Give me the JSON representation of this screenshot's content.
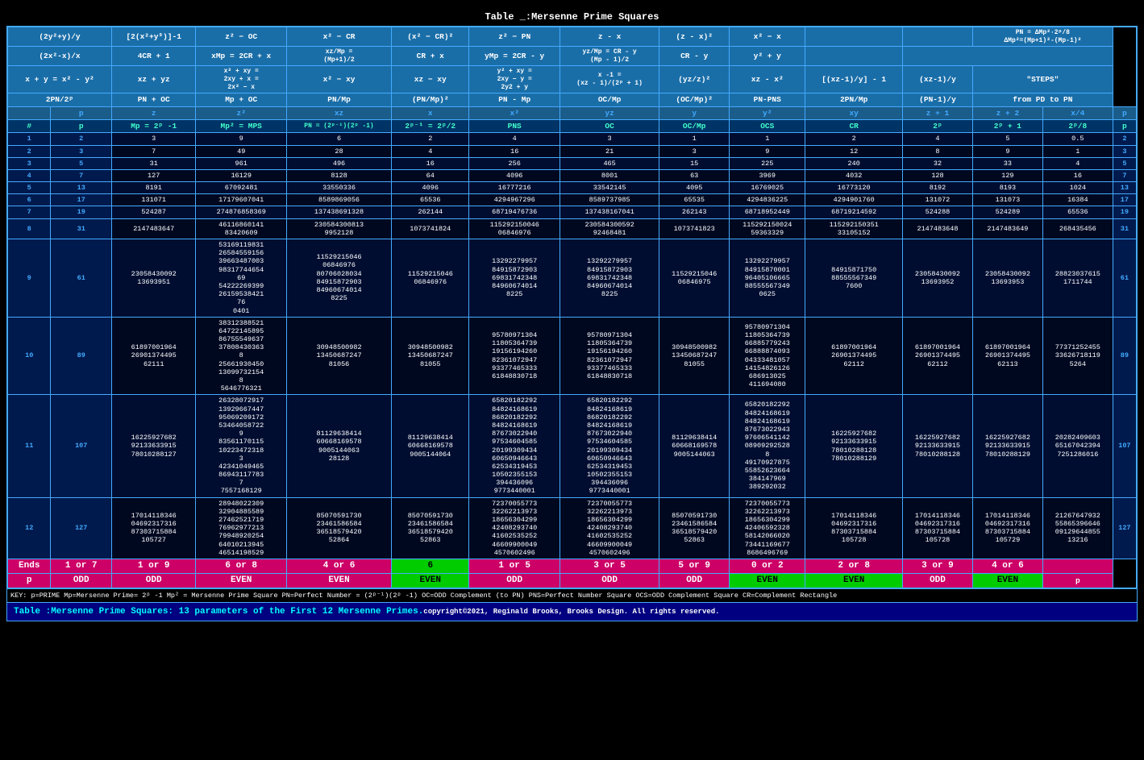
{
  "title": "Table  _:Mersenne Prime Squares",
  "footer": "Table   :Mersenne Prime Squares: 13 parameters of the First 12 Mersenne Primes.",
  "footer_copy": "copyright©2021, Reginald Brooks, Brooks Design. All rights reserved.",
  "key_text": "KEY:  p=PRIME      Mp=Mersenne Prime= 2ᵖ -1      Mp² = Mersenne Prime Square      PN=Perfect Number = (2ᵖ⁻¹)(2ᵖ -1)      OC=ODD Complement (to PN)      PNS=Perfect Number Square      OCS=ODD Complement Square      CR=Complement Rectangle",
  "headers": {
    "row1": [
      "(2y²+y)/y",
      "[2(x²+y⁹)]-1",
      "z² − OC",
      "x² − CR",
      "(x² − CR)²",
      "z² − PN",
      "z - x",
      "(z - x)²",
      "x² − x",
      "",
      "",
      "PN = ΔMp²·2ᵖ/8"
    ],
    "row1_last": "PN = ΔMp²·2ᵖ/8\nΔMp²=(Mp+1)²-\n(Mp-1)²",
    "row2": [
      "(2x²-x)/x",
      "4CR + 1",
      "xMp = 2CR + x",
      "xz/Mp =\n(Mp+1)/2",
      "CR + x",
      "yMp = 2CR - y",
      "yz/Mp = CR - y\n(Mp - 1)/2",
      "CR - y",
      "y² + y",
      "",
      ""
    ],
    "row3": [
      "x + y = x² - y²",
      "xz + yz",
      "x² + xy =\n2xy + x =\n2x² − x",
      "x² − xy",
      "xz − xy",
      "y² + xy =\n2xy − y =\n2y2 + y",
      "x -1 =\n(xz - 1)/(2ᵖ + 1)",
      "(yz/z)²",
      "xz - x²",
      "[(xz-1)/y] - 1",
      "(xz-1)/y",
      "\"STEPS\""
    ],
    "row4": [
      "2PN/2ᵖ",
      "PN + OC",
      "Mp + OC",
      "PN/Mp",
      "(PN/Mp)²",
      "PN - Mp",
      "OC/Mp",
      "(OC/Mp)²",
      "PN-PNS",
      "2PN/Mp",
      "(PN-1)/y",
      "from PD to PN"
    ],
    "row5": [
      "p",
      "z",
      "z²",
      "xz",
      "x",
      "x²",
      "yz",
      "y",
      "y²",
      "xy",
      "z + 1",
      "z + 2",
      "x/4",
      "p"
    ],
    "row6": [
      "#",
      "p",
      "Mp = 2ᵖ -1",
      "Mp² = MPS",
      "PN = (2ᵖ⁻¹)(2ᵖ -1)",
      "2ᵖ⁻¹ = 2ᵖ/2",
      "PNS",
      "OC",
      "OC/Mp",
      "OCS",
      "CR",
      "2ᵖ",
      "2ᵖ + 1",
      "2ᵖ/8",
      "p"
    ]
  },
  "rows": [
    {
      "num": "1",
      "p": "2",
      "mp": "3",
      "mps": "9",
      "pn": "6",
      "half": "2",
      "pns": "4",
      "oc": "3",
      "ocmp": "1",
      "ocs": "1",
      "cr": "2",
      "pow2": "4",
      "pow2p1": "5",
      "pow2d8": "0.5",
      "pr": "2"
    },
    {
      "num": "2",
      "p": "3",
      "mp": "7",
      "mps": "49",
      "pn": "28",
      "half": "4",
      "pns": "16",
      "oc": "21",
      "ocmp": "3",
      "ocs": "9",
      "cr": "12",
      "pow2": "8",
      "pow2p1": "9",
      "pow2d8": "1",
      "pr": "3"
    },
    {
      "num": "3",
      "p": "5",
      "mp": "31",
      "mps": "961",
      "pn": "496",
      "half": "16",
      "pns": "256",
      "oc": "465",
      "ocmp": "15",
      "ocs": "225",
      "cr": "240",
      "pow2": "32",
      "pow2p1": "33",
      "pow2d8": "4",
      "pr": "5"
    },
    {
      "num": "4",
      "p": "7",
      "mp": "127",
      "mps": "16129",
      "pn": "8128",
      "half": "64",
      "pns": "4096",
      "oc": "8001",
      "ocmp": "63",
      "ocs": "3969",
      "cr": "4032",
      "pow2": "128",
      "pow2p1": "129",
      "pow2d8": "16",
      "pr": "7"
    },
    {
      "num": "5",
      "p": "13",
      "mp": "8191",
      "mps": "67092481",
      "pn": "33550336",
      "half": "4096",
      "pns": "16777216",
      "oc": "33542145",
      "ocmp": "4095",
      "ocs": "16769025",
      "cr": "16773120",
      "pow2": "8192",
      "pow2p1": "8193",
      "pow2d8": "1024",
      "pr": "13"
    },
    {
      "num": "6",
      "p": "17",
      "mp": "131071",
      "mps": "17179607041",
      "pn": "8589869056",
      "half": "65536",
      "pns": "4294967296",
      "oc": "8589737985",
      "ocmp": "65535",
      "ocs": "4294836225",
      "cr": "4294901760",
      "pow2": "131072",
      "pow2p1": "131073",
      "pow2d8": "16384",
      "pr": "17"
    },
    {
      "num": "7",
      "p": "19",
      "mp": "524287",
      "mps": "274876858369",
      "pn": "137438691328",
      "half": "262144",
      "pns": "68719476736",
      "oc": "137438167041",
      "ocmp": "262143",
      "ocs": "68718952449",
      "cr": "68719214592",
      "pow2": "524288",
      "pow2p1": "524289",
      "pow2d8": "65536",
      "pr": "19"
    },
    {
      "num": "8",
      "p": "31",
      "mp": "2147483647",
      "mps": "46116860141\n83420609",
      "pn": "230584300813\n9952128",
      "half": "1073741824",
      "pns": "115292150046\n06846976",
      "oc": "230584300592\n92468481",
      "ocmp": "1073741823",
      "ocs": "115292150024\n59363329",
      "cr": "115292150351\n33105152",
      "pow2": "2147483648",
      "pow2p1": "2147483649",
      "pow2d8": "268435456",
      "pr": "31"
    },
    {
      "num": "9",
      "p": "61",
      "mp": "23058430092\n13693951",
      "mps": "53169119831\n26584559156\n39663487003\n98317744654\n69\n54222269399\n26159538421\n76\n0401",
      "pn": "11529215046\n06846976\n80706028034\n84915872903\n84960674014\n8225",
      "half": "11529215046\n06846976",
      "pns": "13292279957\n84915872903\n69831742348\n84960674014\n8225",
      "oc": "13292279957\n84915872903\n69831742348\n84960674014\n8225",
      "ocmp": "11529215046\n06846975",
      "ocs": "13292279957\n84915870001\n96405106665\n88555567349\n0625",
      "cr": "84915871750\n88555567349\n7600",
      "pow2": "23058430092\n13693952",
      "pow2p1": "23058430092\n13693953",
      "pow2d8": "28823037615\n1711744",
      "pr": "61"
    },
    {
      "num": "10",
      "p": "89",
      "mp": "61897001964\n26901374495\n62111",
      "mps": "38312388521\n64722145895\n86755549637\n37808430363\n8\n25661930450\n13099732154\n8\n5646776321",
      "pn": "30948500982\n13450687247\n81056",
      "half": "30948500982\n13450687247\n81055",
      "pns": "95780971304\n11805364739\n19156194260\n82361072947\n93377465333\n61848830718",
      "oc": "95780971304\n11805364739\n19156194260\n82361072947\n93377465333\n61848830718",
      "ocmp": "30948500982\n13450687247\n81055",
      "ocs": "95780971304\n11805364739\n66885779243\n66888874093\n04333481057\n14154826126\n686913025\n411694080",
      "cr": "61897001964\n26901374495\n62112",
      "pow2": "61897001964\n26901374495\n62112",
      "pow2p1": "61897001964\n26901374495\n62113",
      "pow2d8": "77371252455\n33626718119\n5264",
      "pr": "89"
    },
    {
      "num": "11",
      "p": "107",
      "mp": "16225927682\n92133633915\n78010288127",
      "mps": "26328072917\n13929667447\n95069209172\n53464058722\n9\n83561170115\n10223472318\n3\n42341049465\n86943117783\n7\n7557168129",
      "pn": "81129638414\n60668169578\n9005144063\n28128",
      "half": "81129638414\n60668169578\n9005144064",
      "pns": "65820182292\n84824168619\n86820182292\n84824168619\n87673022940\n97534604585\n20199309434\n60650946643\n62534319453\n10502355153\n394436096\n9773440001",
      "oc": "65820182292\n84824168619\n86820182292\n84824168619\n87673022940\n97534604585\n20199309434\n60650946643\n62534319453\n10502355153\n394436096\n9773440001",
      "ocmp": "81129638414\n60668169578\n9005144063",
      "ocs": "65820182292\n84824168619\n84824168619\n87673022943\n97606541142\n08909292528\n8\n49170927875\n55852623664\n384147969\n389292032",
      "cr": "16225927682\n92133633915\n78010288128\n78010288129",
      "pow2": "16225927682\n92133633915\n78010288128",
      "pow2p1": "16225927682\n92133633915\n78010288129",
      "pow2d8": "20282409603\n65167042394\n7251286016",
      "pr": "107"
    },
    {
      "num": "12",
      "p": "127",
      "mp": "17014118346\n04692317316\n87303715884\n105727",
      "mps": "28948022309\n32904885589\n27462521719\n76962977213\n79948920254\n64010213945\n46514198529",
      "pn": "85070591730\n23461586584\n36518579420\n52864",
      "half": "85070591730\n23461586584\n36518579420\n52863",
      "pns": "72370055773\n32262213973\n18656304299\n42408293740\n41602535252\n46609900049\n4570602496",
      "oc": "72370055773\n32262213973\n18656304299\n42408293740\n41602535252\n46609900049\n4570602496",
      "ocmp": "85070591730\n23461586584\n36518579420\n52863",
      "ocs": "72370055773\n32262213973\n18656304299\n42406592328\n58142066020\n73441169677\n8686496769",
      "cr": "17014118346\n04692317316\n87303715884\n105728",
      "pow2": "17014118346\n04692317316\n87303715884\n105728",
      "pow2p1": "17014118346\n04692317316\n87303715884\n105729",
      "pow2d8": "21267647932\n55865396646\n09129644855\n13216",
      "pr": "127"
    }
  ],
  "ends_row": {
    "label": "Ends",
    "values": [
      "1 or 7",
      "1 or 9",
      "6 or 8",
      "4 or 6",
      "6",
      "1 or 5",
      "3 or 5",
      "5 or 9",
      "0 or 2",
      "2 or 8",
      "3 or 9",
      "4 or 6"
    ],
    "green_indices": [
      4
    ]
  },
  "p_row": {
    "label": "p",
    "values": [
      "ODD",
      "ODD",
      "EVEN",
      "EVEN",
      "EVEN",
      "ODD",
      "ODD",
      "ODD",
      "EVEN",
      "EVEN",
      "ODD",
      "EVEN"
    ],
    "green_indices": [
      4,
      8,
      9,
      11
    ]
  }
}
